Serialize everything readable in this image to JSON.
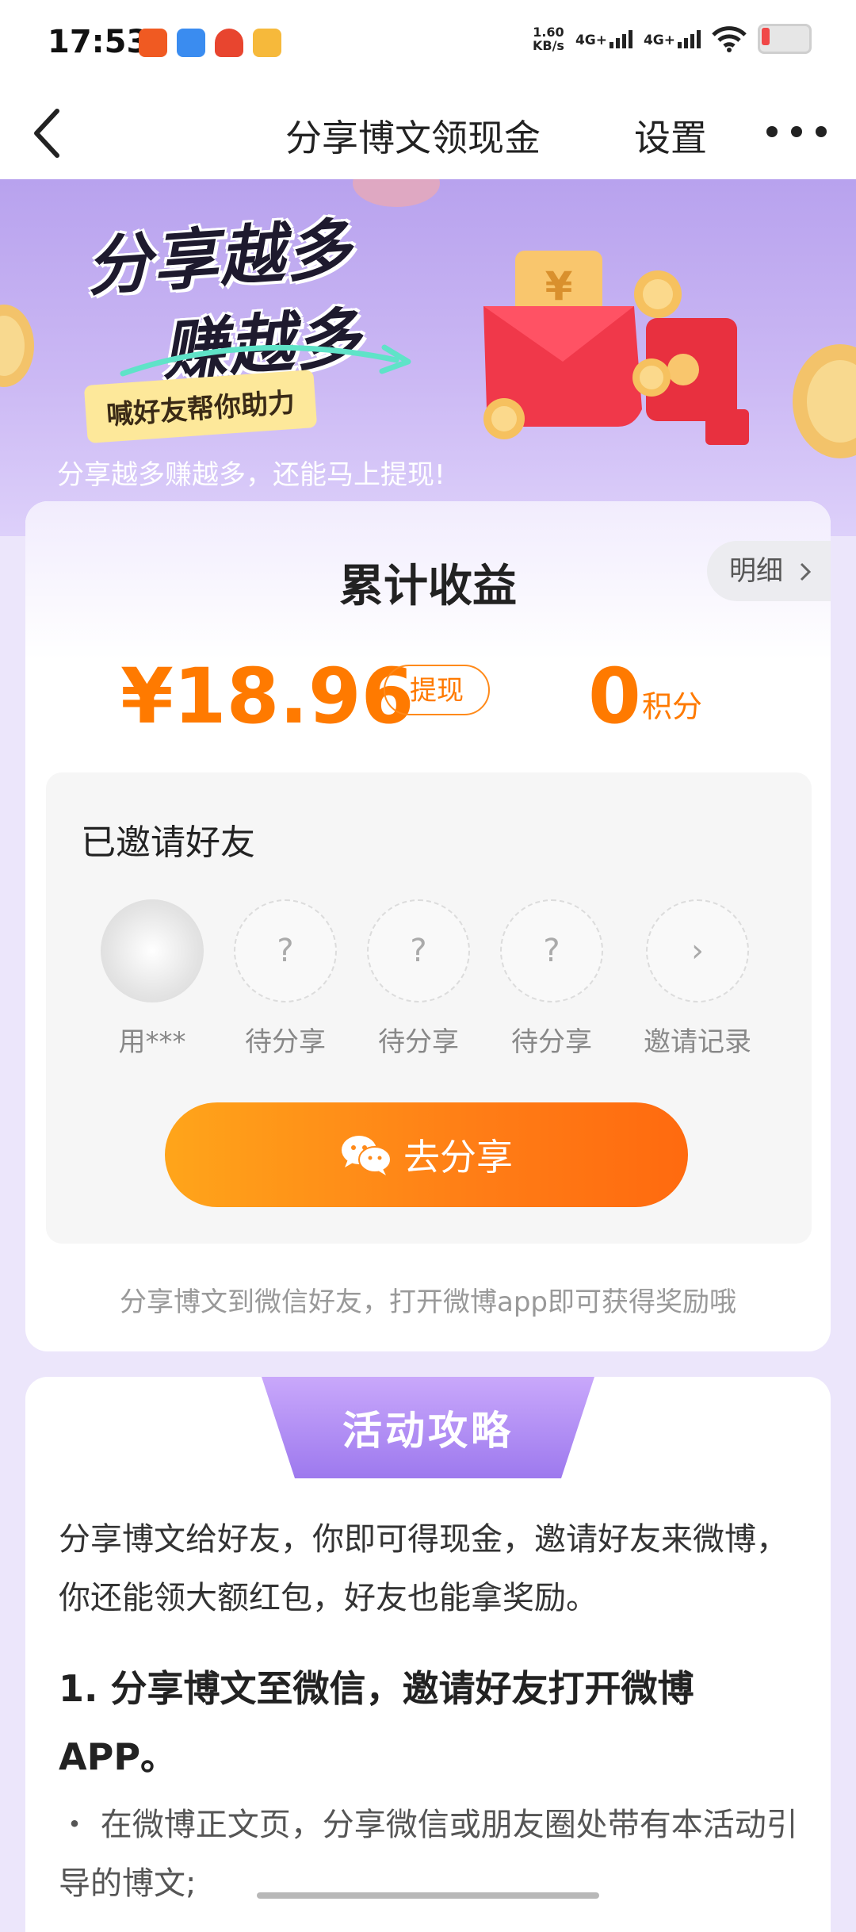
{
  "status_bar": {
    "time": "17:53",
    "speed_value": "1.60",
    "speed_unit": "KB/s",
    "signal1": "4G+",
    "signal2": "4G+"
  },
  "nav": {
    "title": "分享博文领现金",
    "settings": "设置"
  },
  "banner": {
    "headline_line1": "分享越多",
    "headline_line2": "赚越多",
    "tag": "喊好友帮你助力",
    "subtitle": "分享越多赚越多，还能马上提现!"
  },
  "earnings": {
    "title": "累计收益",
    "detail_label": "明细",
    "amount": "¥18.96",
    "withdraw_label": "提现",
    "points_value": "0",
    "points_label": "积分"
  },
  "invite": {
    "title": "已邀请好友",
    "slots": [
      {
        "label": "用***"
      },
      {
        "label": "待分享",
        "symbol": "?"
      },
      {
        "label": "待分享",
        "symbol": "?"
      },
      {
        "label": "待分享",
        "symbol": "?"
      },
      {
        "label": "邀请记录",
        "symbol": "›"
      }
    ],
    "share_button": "去分享",
    "footer_note": "分享博文到微信好友，打开微博app即可获得奖励哦"
  },
  "guide": {
    "tab_title": "活动攻略",
    "intro": "分享博文给好友，你即可得现金，邀请好友来微博，你还能领大额红包，好友也能拿奖励。",
    "step1_title": "1. 分享博文至微信，邀请好友打开微博APP。",
    "step1_bullet": "・ 在微博正文页，分享微信或朋友圈处带有本活动引导的博文;"
  }
}
